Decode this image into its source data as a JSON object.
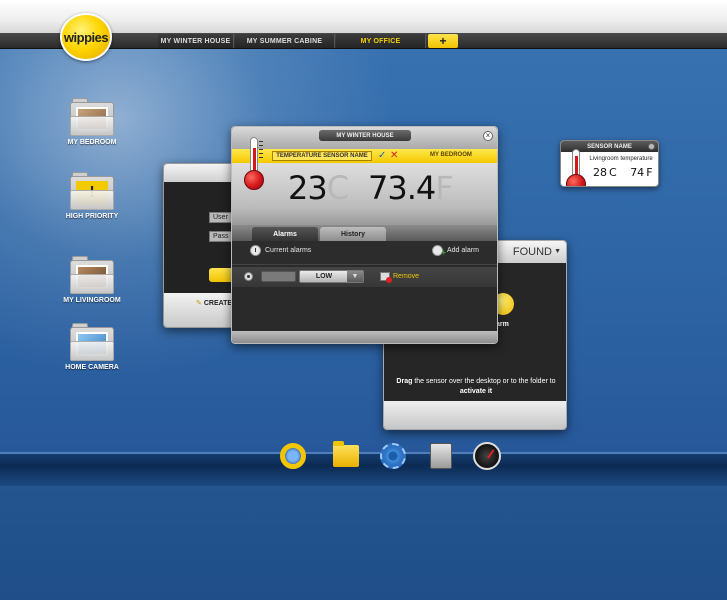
{
  "app": {
    "logo_text": "wippies"
  },
  "tabs": [
    {
      "label": "MY WINTER HOUSE",
      "active": false
    },
    {
      "label": "MY SUMMER CABINE",
      "active": false
    },
    {
      "label": "MY OFFICE",
      "active": true
    }
  ],
  "add_tab_label": "+",
  "desktop_icons": [
    {
      "label": "MY BEDROOM",
      "icon": "bedroom-folder-icon"
    },
    {
      "label": "HIGH PRIORITY",
      "icon": "warning-folder-icon"
    },
    {
      "label": "MY LIVINGROOM",
      "icon": "livingroom-folder-icon"
    },
    {
      "label": "HOME CAMERA",
      "icon": "camera-folder-icon"
    }
  ],
  "login_window": {
    "user_field": "User",
    "pass_field": "Pass",
    "create_label": "CREATE"
  },
  "found_window": {
    "title": "FOUND",
    "item_label": "arm",
    "message_prefix": "Drag",
    "message_middle": " the sensor over the desktop or to the folder to ",
    "message_bold": "activate it"
  },
  "sensor_window": {
    "title": "MY WINTER HOUSE",
    "sensor_name": "TEMPERATURE SENSOR NAME",
    "room": "MY BEDROOM",
    "temperature": {
      "value": "23",
      "unit": "C"
    },
    "humidity": {
      "value": "73.4",
      "unit": "F"
    },
    "tabs": {
      "alarms": "Alarms",
      "history": "History"
    },
    "current_alarms_label": "Current alarms",
    "add_alarm_label": "Add alarm",
    "alarm_row": {
      "level": "LOW",
      "remove_label": "Remove"
    },
    "close_glyph": "×",
    "check_glyph": "✓",
    "cancel_glyph": "✕"
  },
  "widget": {
    "title": "SENSOR NAME",
    "description": "Livingroom temperature",
    "temp_value": "28",
    "temp_unit": "C",
    "second_value": "74",
    "second_unit": "F"
  },
  "dock": [
    "ring-icon",
    "folder-icon",
    "settings-gear-icon",
    "calculator-icon",
    "gauge-icon"
  ],
  "colors": {
    "accent_yellow": "#f4c800",
    "desktop_blue": "#2f67a6",
    "alarm_red": "#d3171b"
  }
}
